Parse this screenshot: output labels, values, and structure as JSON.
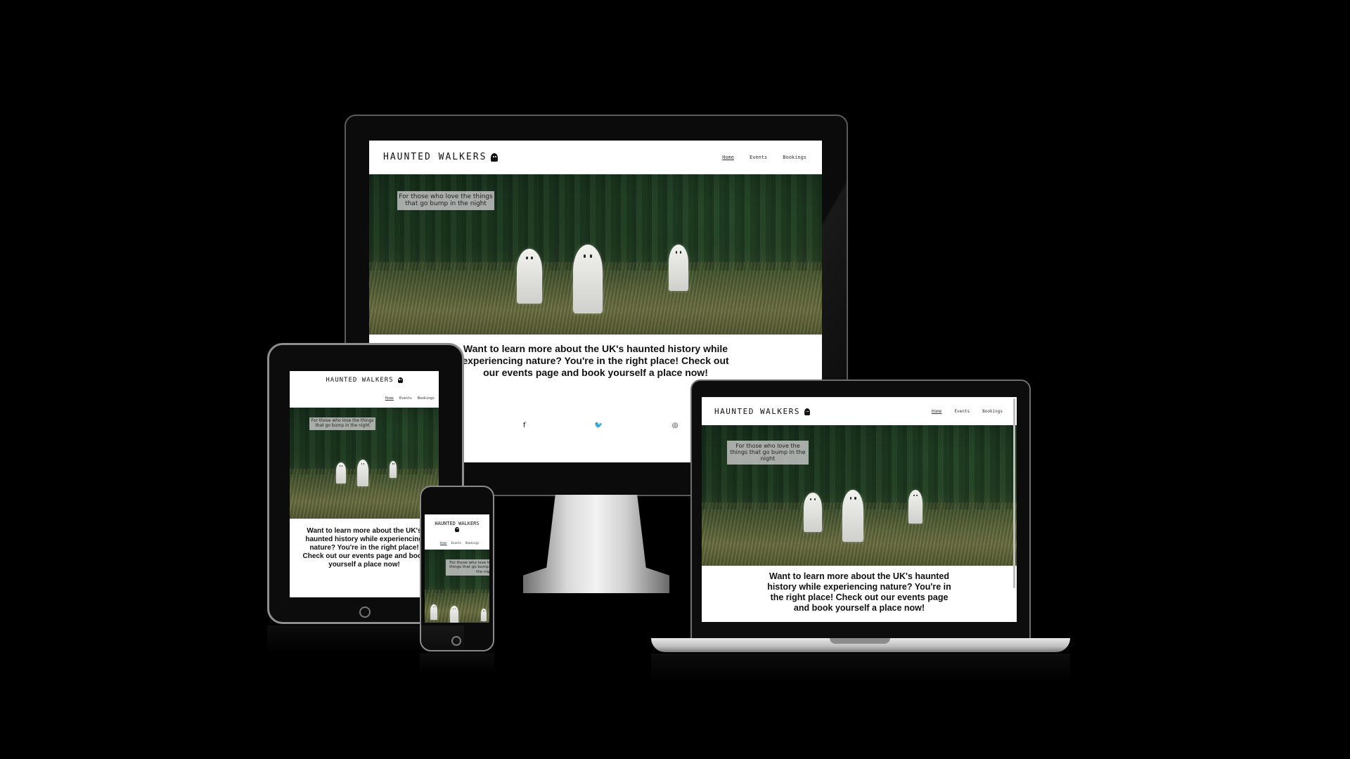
{
  "site": {
    "logo_text": "HAUNTED WALKERS",
    "nav_links": [
      "Home",
      "Events",
      "Bookings"
    ],
    "tagline": "For those who love the things that go bump in the night",
    "intro": "Want to learn more about the UK's haunted history while experiencing nature? You're in the right place! Check out our events page and book yourself a place now!",
    "social_icons": [
      "facebook-icon",
      "twitter-icon",
      "instagram-icon",
      "youtube-icon"
    ]
  },
  "social_glyphs": [
    "f",
    "🐦",
    "◎",
    "▶"
  ],
  "colors": {
    "background": "#000000",
    "screen": "#ffffff",
    "tagline_box": "#c8c8c8"
  }
}
